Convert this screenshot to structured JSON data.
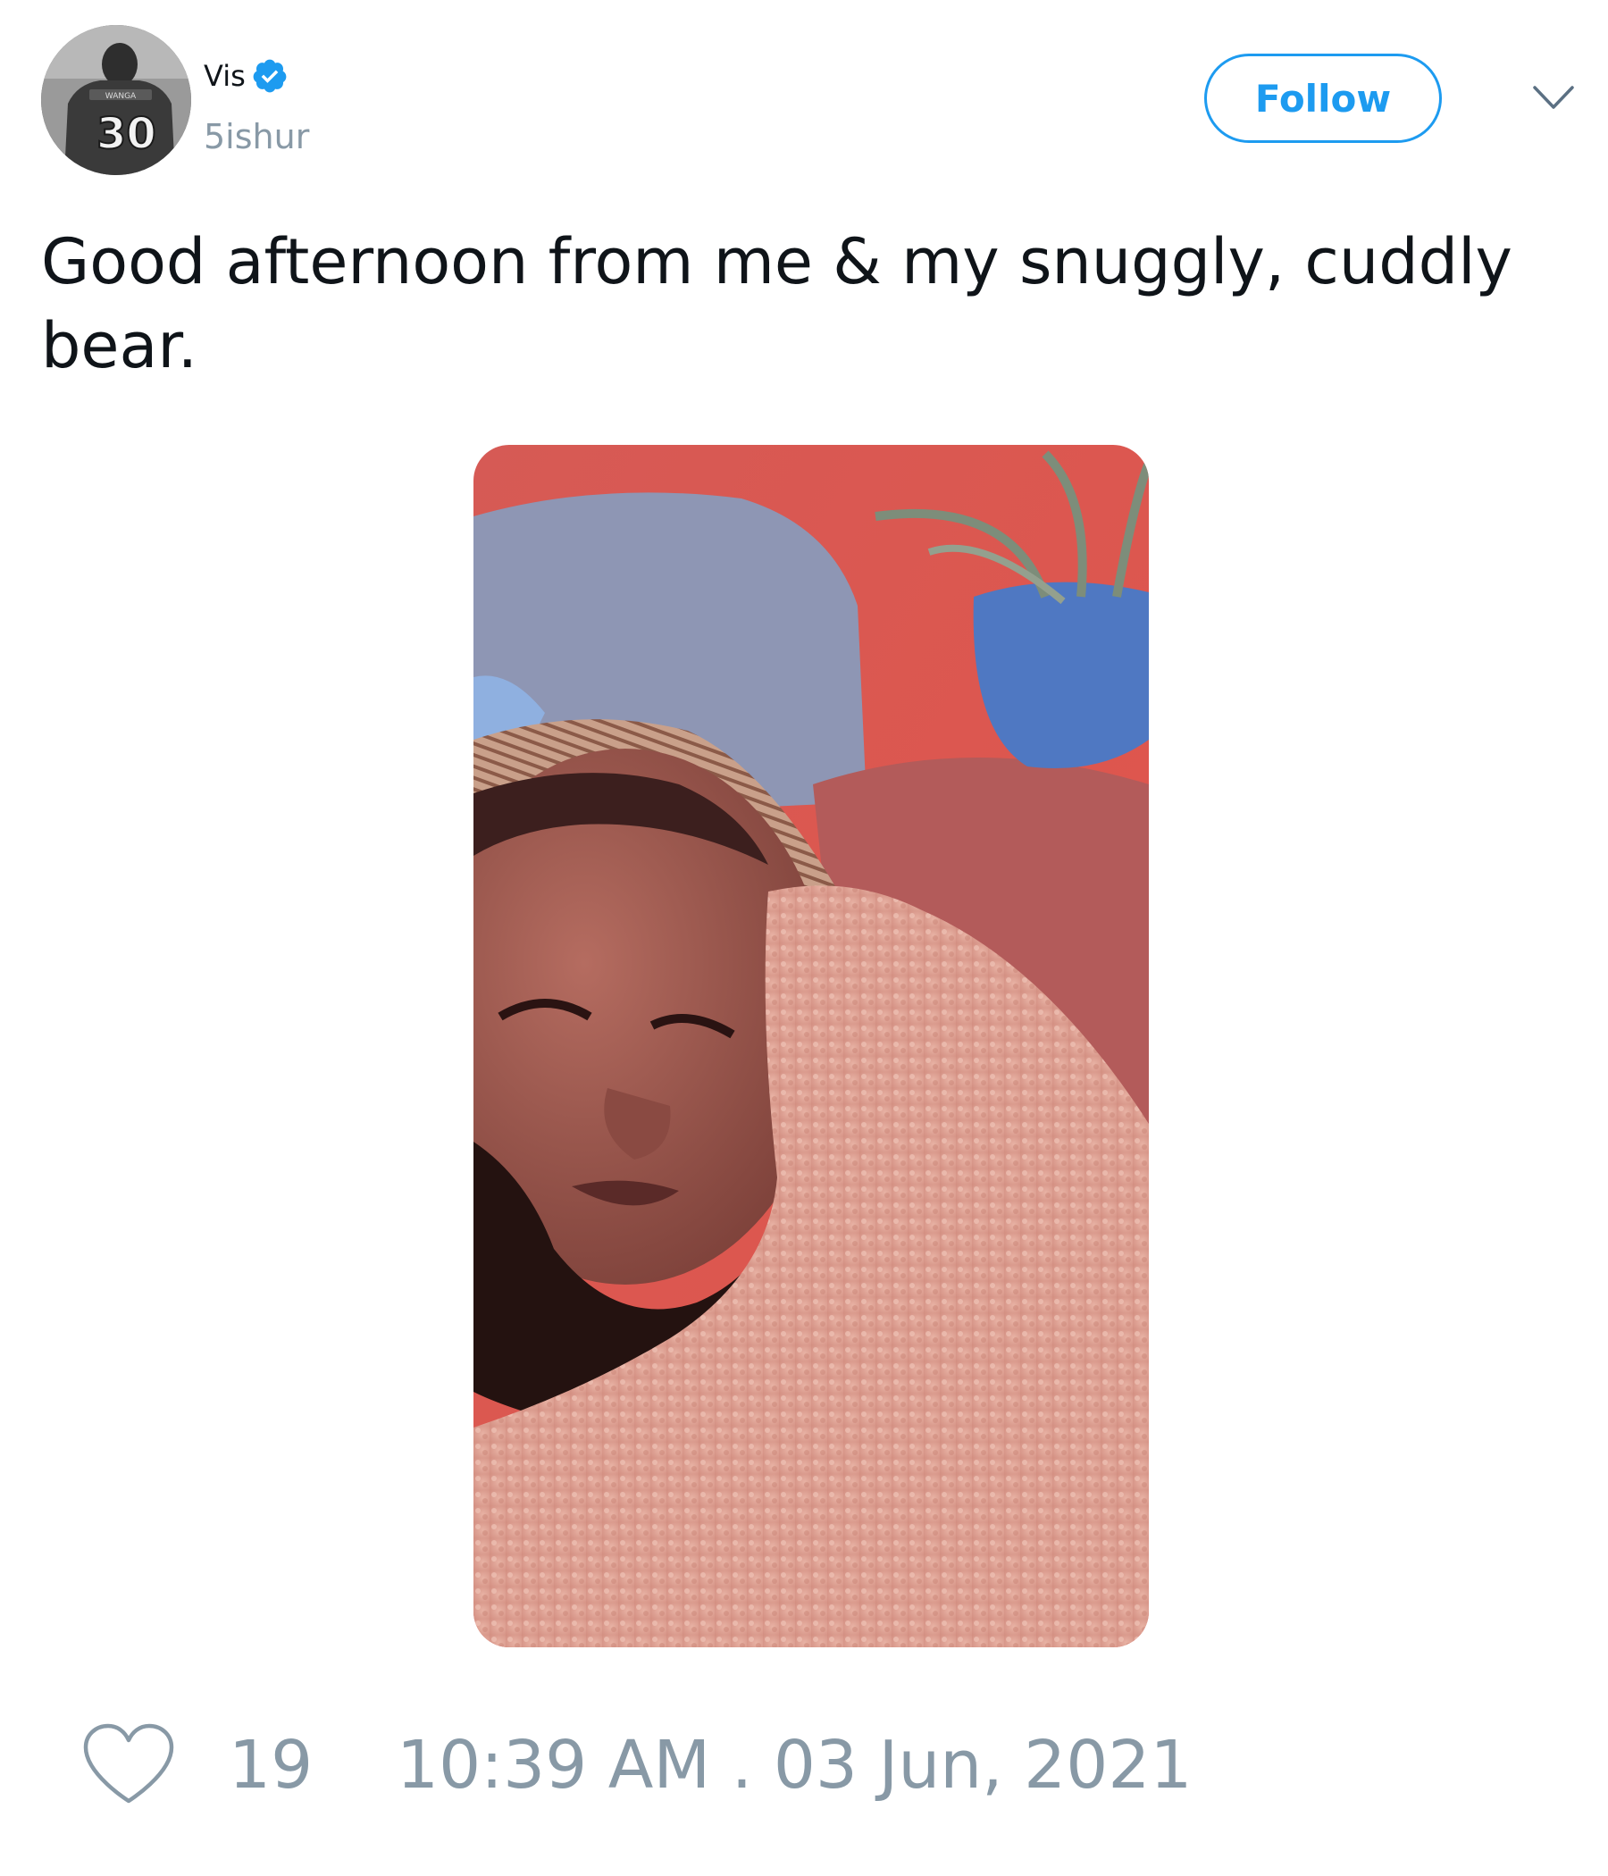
{
  "author": {
    "display_name": "Vis",
    "handle": "5ishur",
    "verified": true,
    "avatar_icon": "user-avatar",
    "avatar_jersey_number": "30",
    "avatar_jersey_name": "WANGA"
  },
  "actions": {
    "follow_label": "Follow",
    "menu_icon": "chevron-down-icon"
  },
  "tweet": {
    "text": "Good afternoon from me & my snuggly, cuddly bear."
  },
  "media": {
    "type": "photo",
    "alt_icon": "photo-icon"
  },
  "footer": {
    "like_icon": "heart-outline-icon",
    "like_count": "19",
    "timestamp": "10:39 AM . 03 Jun, 2021"
  },
  "colors": {
    "accent": "#1d9bf0",
    "muted": "#8899a6",
    "text": "#0f1419",
    "background": "#ffffff"
  }
}
